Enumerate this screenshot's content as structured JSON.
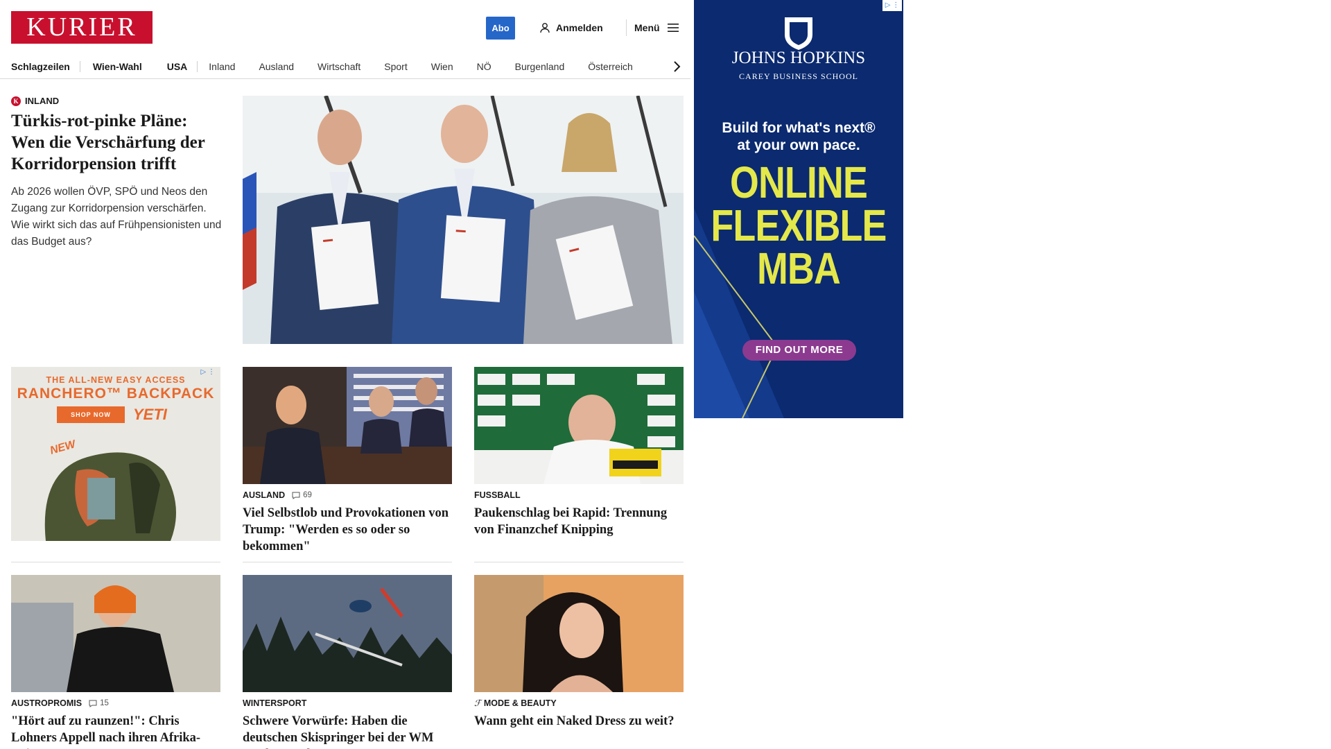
{
  "brand": {
    "logo_text": "KURIER",
    "color": "#c8102e"
  },
  "header": {
    "abo_label": "Abo",
    "login_label": "Anmelden",
    "menu_label": "Menü"
  },
  "nav": {
    "items": [
      "Schlagzeilen",
      "Wien-Wahl",
      "USA",
      "Inland",
      "Ausland",
      "Wirtschaft",
      "Sport",
      "Wien",
      "NÖ",
      "Burgenland",
      "Österreich"
    ]
  },
  "hero": {
    "kicker": "INLAND",
    "title": "Türkis-rot-pinke Pläne: Wen die Verschärfung der Korridorpension trifft",
    "lead": "Ab 2026 wollen ÖVP, SPÖ und Neos den Zugang zur Korridorpension verschärfen. Wie wirkt sich das auf Frühpensionisten und das Budget aus?"
  },
  "ad_small": {
    "line1": "THE ALL-NEW EASY ACCESS",
    "line2": "RANCHERO™ BACKPACK",
    "shop": "SHOP NOW",
    "brand": "YETI",
    "badge": "NEW"
  },
  "cards": [
    {
      "section": "AUSLAND",
      "comments": "69",
      "title": "Viel Selbstlob und Provokationen von Trump: \"Werden es so oder so bekommen\""
    },
    {
      "section": "FUSSBALL",
      "comments": "",
      "title": "Paukenschlag bei Rapid: Trennung von Finanzchef Knipping"
    },
    {
      "section": "AUSTROPROMIS",
      "comments": "15",
      "title": "\"Hört auf zu raunzen!\": Chris Lohners Appell nach ihren Afrika-Reisen"
    },
    {
      "section": "WINTERSPORT",
      "comments": "",
      "title": "Schwere Vorwürfe: Haben die deutschen Skispringer bei der WM geschummelt?"
    },
    {
      "section": "MODE & BEAUTY",
      "comments": "",
      "title": "Wann geht ein Naked Dress zu weit?"
    }
  ],
  "side_ad": {
    "name": "JOHNS HOPKINS",
    "sub": "CAREY BUSINESS SCHOOL",
    "tagline1": "Build for what's next®",
    "tagline2": "at your own pace.",
    "big1": "ONLINE",
    "big2": "FLEXIBLE",
    "big3": "MBA",
    "cta": "FIND OUT MORE"
  }
}
